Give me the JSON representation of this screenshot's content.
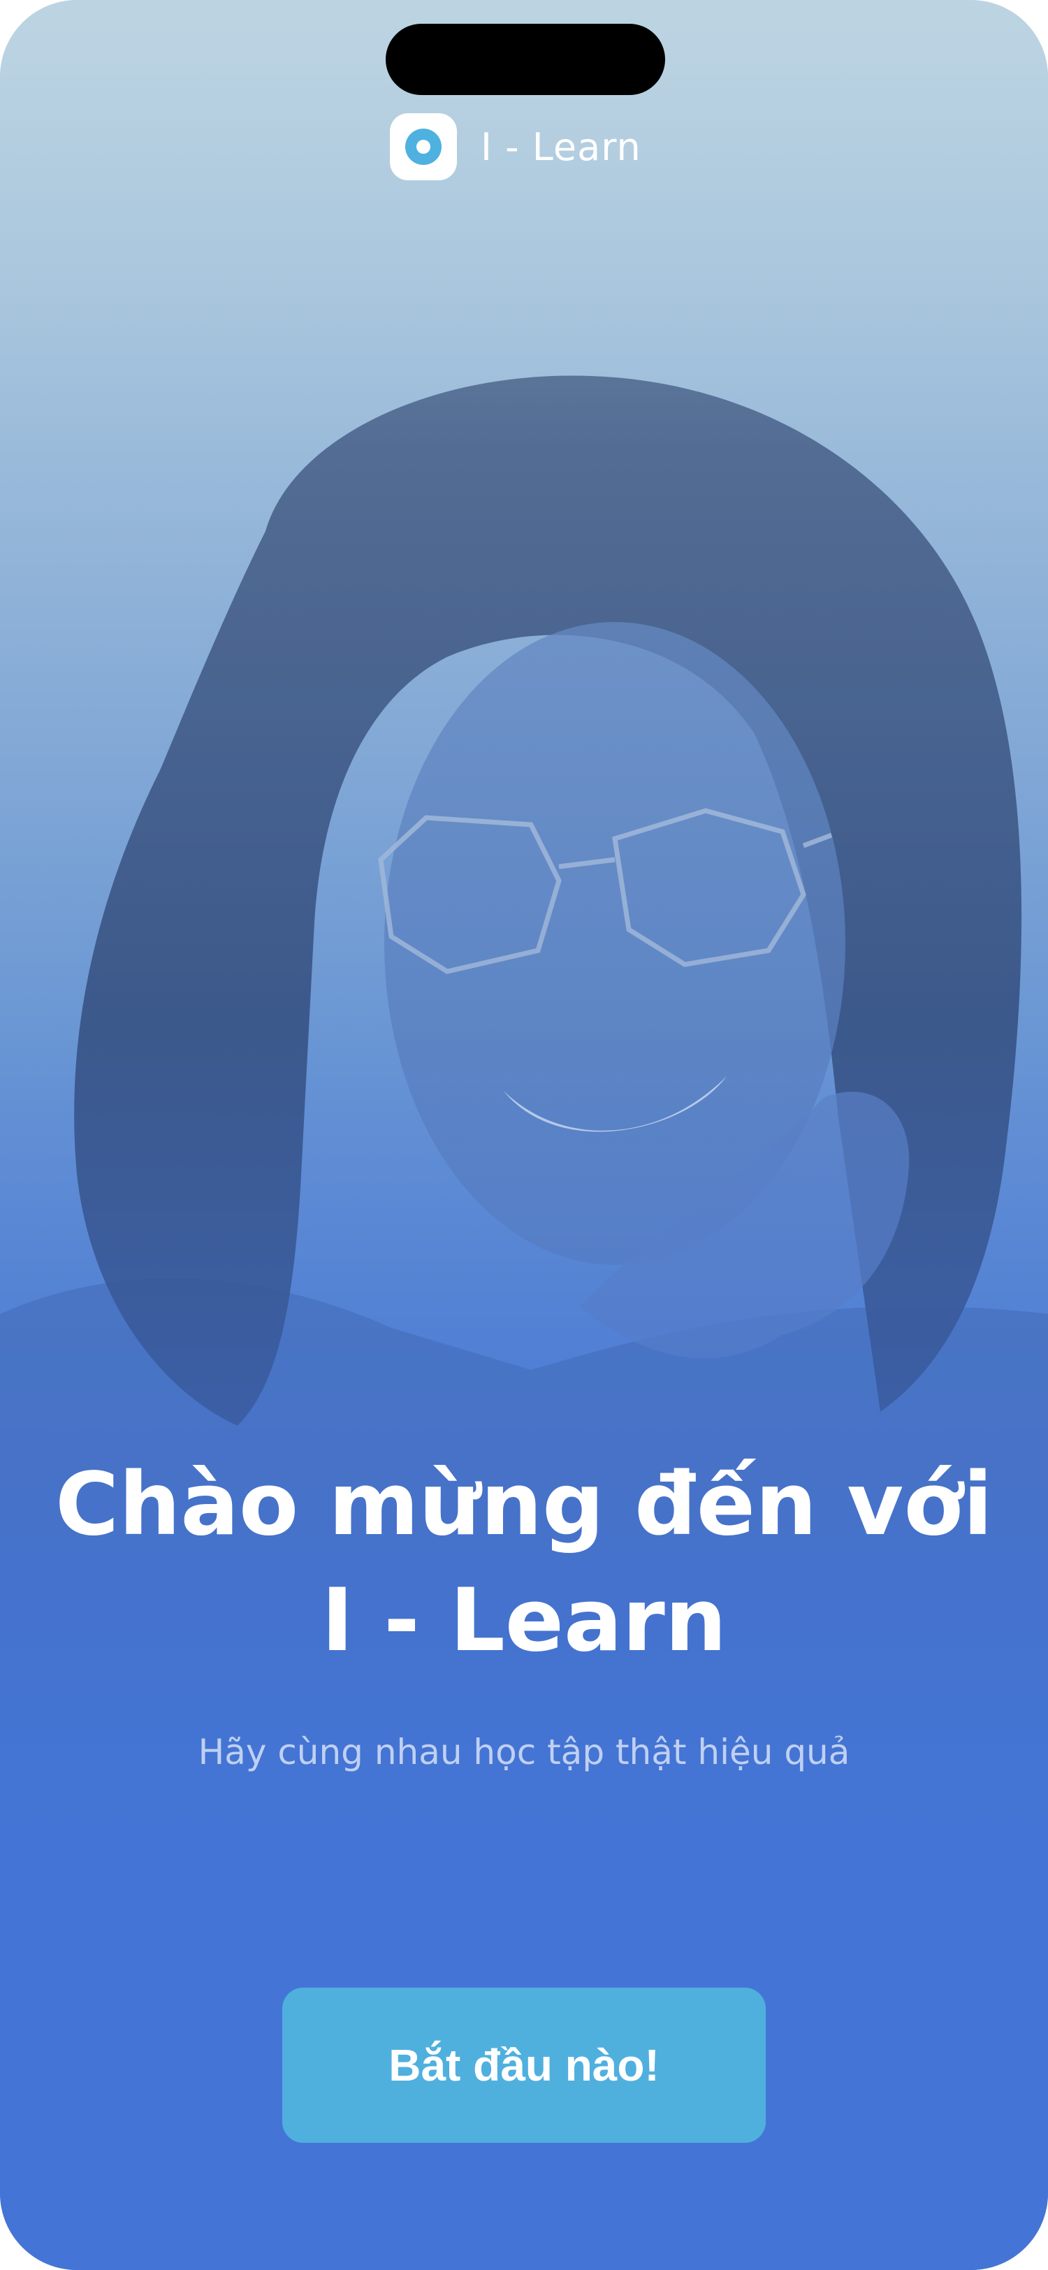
{
  "app": {
    "name": "I - Learn",
    "logo_icon": "target-dot-icon"
  },
  "welcome": {
    "title_line1": "Chào mừng đến với",
    "title_line2": "I - Learn",
    "subtitle": "Hãy cùng nhau học tập thật hiệu quả"
  },
  "actions": {
    "start_label": "Bắt đầu nào!"
  },
  "colors": {
    "accent": "#4fb0de",
    "background_bottom": "#4475d6",
    "background_top": "#c1d7e2"
  }
}
